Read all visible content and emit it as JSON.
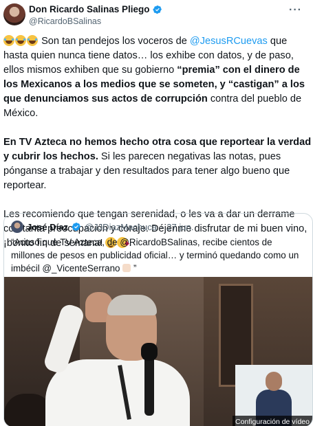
{
  "tweet": {
    "author_name": "Don Ricardo Salinas Pliego",
    "author_handle": "@RicardoBSalinas",
    "more_icon": "more-icon",
    "verified_icon": "verified-badge-icon",
    "paragraph1": {
      "t1": "Son tan pendejos los voceros de ",
      "mention": "@JesusRCuevas",
      "t2": " que hasta quien nunca tiene datos… los exhibe con datos, y de paso, ellos mismos exhiben que su gobierno ",
      "b1": "“premia” con el dinero de los Mexicanos a los medios que se someten, y “castigan” a los que denunciamos sus actos de corrupción",
      "t3": " contra del pueblo de México."
    },
    "paragraph2": {
      "b1": "En TV Azteca no hemos hecho otra cosa que reportear la verdad y cubrir los hechos.",
      "t1": " Si les parecen negativas las notas, pues pónganse a trabajar y den resultados para tener algo bueno que reportear."
    },
    "paragraph3": {
      "t1": "Les recomiendo que tengan serenidad, o les va a dar un derrame con tanta preocupación y coraje. Déjenme disfrutar de mi buen vino, ¡bonito fin de semana!",
      "t2": "."
    }
  },
  "quoted": {
    "author_name": "José Díaz",
    "author_handle": "@JJDiazMachuca",
    "separator": "·",
    "date": "27 jun.",
    "text_before": "“Acusó que TV Azteca, de ",
    "mention1": "@RicardoBSalinas",
    "text_middle": ", recibe cientos de millones de pesos en publicidad oficial… y terminó quedando como un imbécil ",
    "mention2": "@_VicenteSerrano",
    "text_after": "”",
    "video_caption": "Configuración de vídeo"
  },
  "colors": {
    "link": "#1d9bf0",
    "text": "#0f1419",
    "muted": "#536471",
    "border": "#cfd9de"
  }
}
